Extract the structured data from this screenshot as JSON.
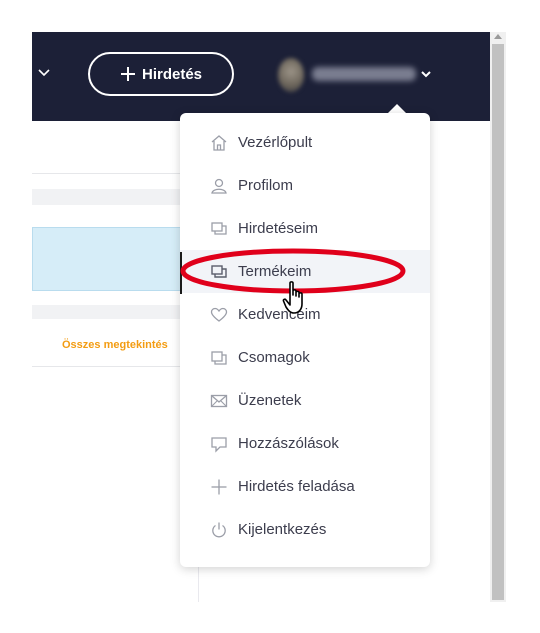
{
  "header": {
    "new_ad_button": "Hirdetés"
  },
  "page": {
    "view_all_link": "Összes megtekintés"
  },
  "user_menu": {
    "items": [
      {
        "label": "Vezérlőpult",
        "icon": "home-icon"
      },
      {
        "label": "Profilom",
        "icon": "user-icon"
      },
      {
        "label": "Hirdetéseim",
        "icon": "ads-icon"
      },
      {
        "label": "Termékeim",
        "icon": "products-icon"
      },
      {
        "label": "Kedvenceim",
        "icon": "heart-icon"
      },
      {
        "label": "Csomagok",
        "icon": "packages-icon"
      },
      {
        "label": "Üzenetek",
        "icon": "mail-icon"
      },
      {
        "label": "Hozzászólások",
        "icon": "comment-icon"
      },
      {
        "label": "Hirdetés feladása",
        "icon": "plus-icon"
      },
      {
        "label": "Kijelentkezés",
        "icon": "power-icon"
      }
    ],
    "highlighted_item": "Termékeim"
  },
  "colors": {
    "header_bg": "#1c2037",
    "menu_text": "#3c3d4d",
    "icon_gray": "#9b9ea8",
    "link_orange": "#f39c12",
    "annotation_red": "#e0001b",
    "highlight_bg": "#f2f4f8"
  }
}
